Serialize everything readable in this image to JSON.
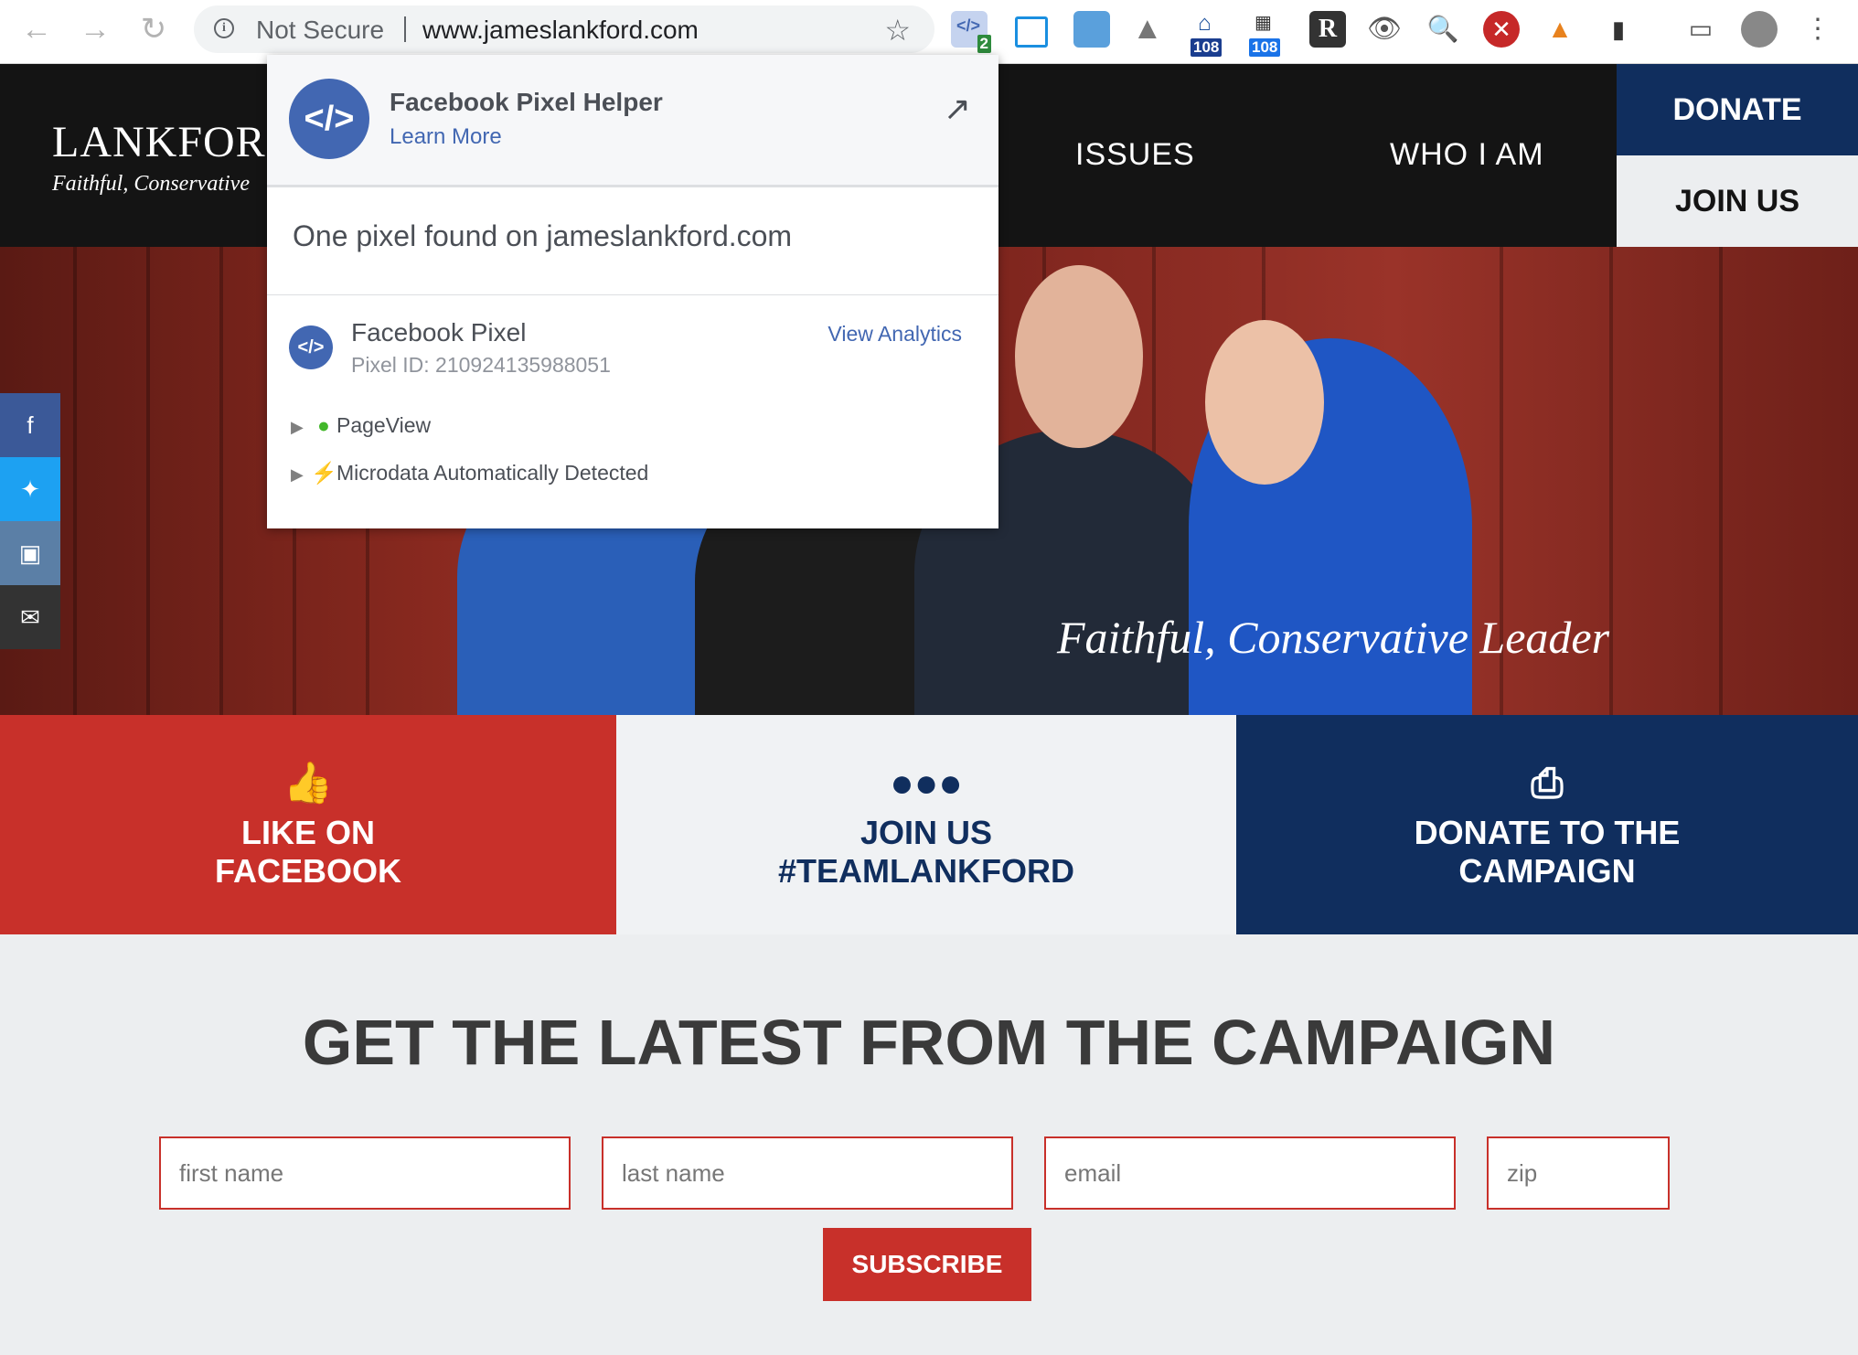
{
  "browser": {
    "url_security": "Not Secure",
    "url": "www.jameslankford.com",
    "extension_badges": {
      "pixel": "2",
      "ext_a": "108",
      "ext_b": "108"
    }
  },
  "site": {
    "logo": "LANKFOR",
    "tagline": "Faithful, Conservative",
    "nav": {
      "issues": "ISSUES",
      "who": "WHO I AM"
    },
    "donate": "DONATE",
    "join": "JOIN US",
    "hero_caption": "Faithful, Conservative Leader",
    "cta": [
      {
        "label_1": "LIKE ON",
        "label_2": "FACEBOOK"
      },
      {
        "label_1": "JOIN US",
        "label_2": "#TEAMLANKFORD"
      },
      {
        "label_1": "DONATE TO THE",
        "label_2": "CAMPAIGN"
      }
    ],
    "signup_title": "GET THE LATEST FROM THE CAMPAIGN",
    "form": {
      "first": "first name",
      "last": "last name",
      "email": "email",
      "zip": "zip",
      "subscribe": "SUBSCRIBE"
    }
  },
  "popup": {
    "title": "Facebook Pixel Helper",
    "learn_more": "Learn More",
    "found": "One pixel found on jameslankford.com",
    "pixel_name": "Facebook Pixel",
    "pixel_id": "Pixel ID: 210924135988051",
    "view_analytics": "View Analytics",
    "events": [
      "PageView",
      "Microdata Automatically Detected"
    ]
  },
  "colors": {
    "brand_red": "#c8302a",
    "brand_navy": "#102e5e",
    "facebook_blue": "#4267b2"
  }
}
